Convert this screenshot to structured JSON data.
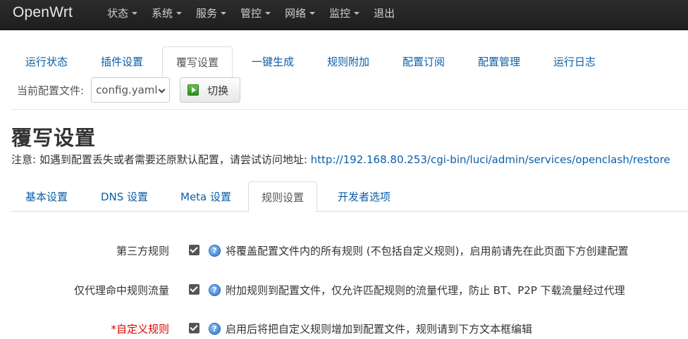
{
  "brand": "OpenWrt",
  "nav": [
    {
      "label": "状态",
      "dropdown": true
    },
    {
      "label": "系统",
      "dropdown": true
    },
    {
      "label": "服务",
      "dropdown": true
    },
    {
      "label": "管控",
      "dropdown": true
    },
    {
      "label": "网络",
      "dropdown": true
    },
    {
      "label": "监控",
      "dropdown": true
    },
    {
      "label": "退出",
      "dropdown": false
    }
  ],
  "main_tabs": [
    "运行状态",
    "插件设置",
    "覆写设置",
    "一键生成",
    "规则附加",
    "配置订阅",
    "配置管理",
    "运行日志"
  ],
  "main_tab_active": "覆写设置",
  "config": {
    "label": "当前配置文件:",
    "selected": "config.yaml",
    "switch_label": "切换"
  },
  "page_title": "覆写设置",
  "notice": {
    "text": "注意: 如遇到配置丢失或者需要还原默认配置，请尝试访问地址: ",
    "link": "http://192.168.80.253/cgi-bin/luci/admin/services/openclash/restore"
  },
  "sub_tabs": [
    "基本设置",
    "DNS 设置",
    "Meta 设置",
    "规则设置",
    "开发者选项"
  ],
  "sub_tab_active": "规则设置",
  "options": [
    {
      "label": "第三方规则",
      "required": false,
      "checked": true,
      "desc": "将覆盖配置文件内的所有规则 (不包括自定义规则)，启用前请先在此页面下方创建配置"
    },
    {
      "label": "仅代理命中规则流量",
      "required": false,
      "checked": true,
      "desc": "附加规则到配置文件，仅允许匹配规则的流量代理，防止 BT、P2P 下载流量经过代理"
    },
    {
      "label": "*自定义规则",
      "required": true,
      "checked": true,
      "desc": "启用后将把自定义规则增加到配置文件，规则请到下方文本框编辑"
    }
  ],
  "colors": {
    "link": "#0a5ea8",
    "required": "#e00000",
    "navbar": "#1e1e1e"
  },
  "icons": {
    "help": "help-icon",
    "switch": "play-icon",
    "caret": "chevron-down-icon"
  }
}
